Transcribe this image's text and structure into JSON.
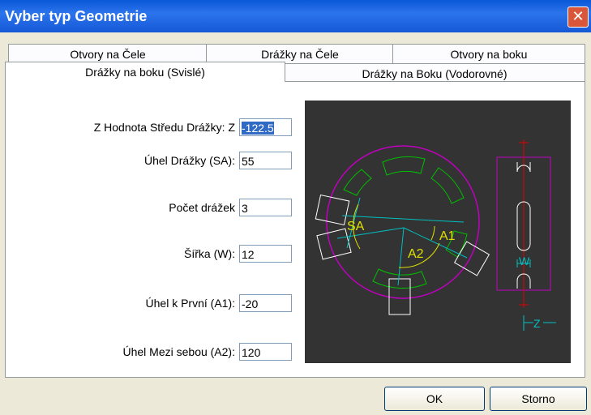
{
  "window": {
    "title": "Vyber typ Geometrie",
    "close_glyph": "✕"
  },
  "tabs_back": [
    "Otvory na Čele",
    "Drážky na Čele",
    "Otvory na boku"
  ],
  "tabs_front": [
    "Drážky na boku (Svislé)",
    "Drážky na Boku (Vodorovné)"
  ],
  "fields": [
    {
      "label": "Z Hodnota Středu Drážky: Z",
      "value": "-122.5"
    },
    {
      "label": "Úhel Drážky (SA):",
      "value": "55"
    },
    {
      "label": "Počet drážek",
      "value": "3"
    },
    {
      "label": "Šířka (W):",
      "value": "12"
    },
    {
      "label": "Úhel k První (A1):",
      "value": "-20"
    },
    {
      "label": "Úhel Mezi sebou (A2):",
      "value": "120"
    }
  ],
  "diagram": {
    "sa": "SA",
    "a1": "A1",
    "a2": "A2",
    "w": "W",
    "z": "Z"
  },
  "buttons": {
    "ok": "OK",
    "cancel": "Storno"
  },
  "colors": {
    "title_bar": "#2b74ec",
    "magenta": "#c000c0",
    "cyan": "#00c0c0",
    "yellow": "#e0e000",
    "green": "#00c000",
    "red": "#e00000"
  }
}
